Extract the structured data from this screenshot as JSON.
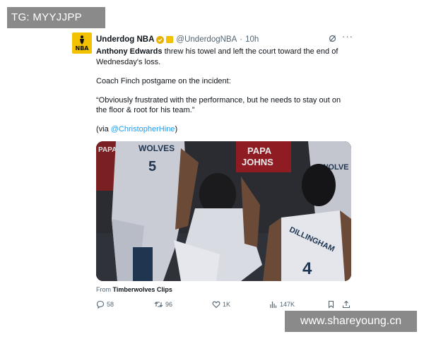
{
  "watermarks": {
    "top": "TG: MYYJJPP",
    "bottom": "www.shareyoung.cn"
  },
  "account": {
    "name": "Underdog NBA",
    "handle": "@UnderdogNBA",
    "time": "10h",
    "avatar_text": "NBA"
  },
  "tweet": {
    "player": "Anthony Edwards",
    "line1_rest": " threw his towel and left the court toward the end of",
    "line2": "Wednesday's loss.",
    "para2": "Coach Finch postgame on the incident:",
    "quote_line1": "“Obviously frustrated with the performance, but he needs to stay out on",
    "quote_line2": "the floor & root for his team.”",
    "via_prefix": "(via ",
    "via_handle": "@ChristopherHine",
    "via_suffix": ")"
  },
  "media": {
    "jersey_left_text": "WOLVES",
    "jersey_left_number": "5",
    "jersey_right_text": "DILLINGHAM",
    "jersey_right_number": "4",
    "banner_text_line1": "PAPA",
    "banner_text_line2": "JOHNS",
    "jersey_top_right_text": "WOLVE",
    "banner_left_text": "PAPA"
  },
  "source": {
    "prefix": "From ",
    "name": "Timberwolves Clips"
  },
  "actions": {
    "replies": "58",
    "reposts": "96",
    "likes": "1K",
    "views": "147K"
  },
  "icons": [
    "verified-badge-icon",
    "affiliate-icon",
    "grok-icon",
    "more-icon",
    "reply-icon",
    "repost-icon",
    "like-icon",
    "views-icon",
    "bookmark-icon",
    "share-icon"
  ],
  "colors": {
    "link": "#1d9bf0",
    "muted": "#536471",
    "text": "#0f1419",
    "watermark_bg": "#8a8a8a",
    "avatar_bg": "#f2c200"
  }
}
